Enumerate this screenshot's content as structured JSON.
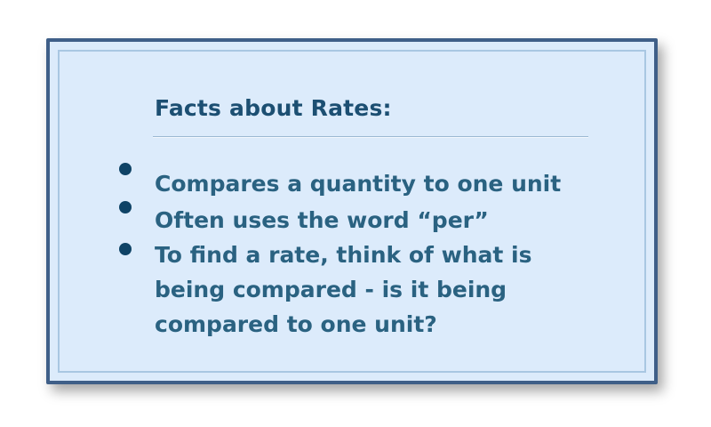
{
  "title": "Facts about Rates:",
  "bullets": [
    {
      "lines": [
        "Compares a quantity to one unit"
      ]
    },
    {
      "lines": [
        "Often uses the word “per”"
      ]
    },
    {
      "lines": [
        "To find a rate, think of what is",
        "being compared - is it being",
        "compared to one unit?"
      ]
    }
  ],
  "colors": {
    "title": "#1c4f72",
    "text": "#2a6281",
    "bullet": "#0f4366",
    "card_bg": "#dcebfb",
    "border": "#3f5f88"
  }
}
